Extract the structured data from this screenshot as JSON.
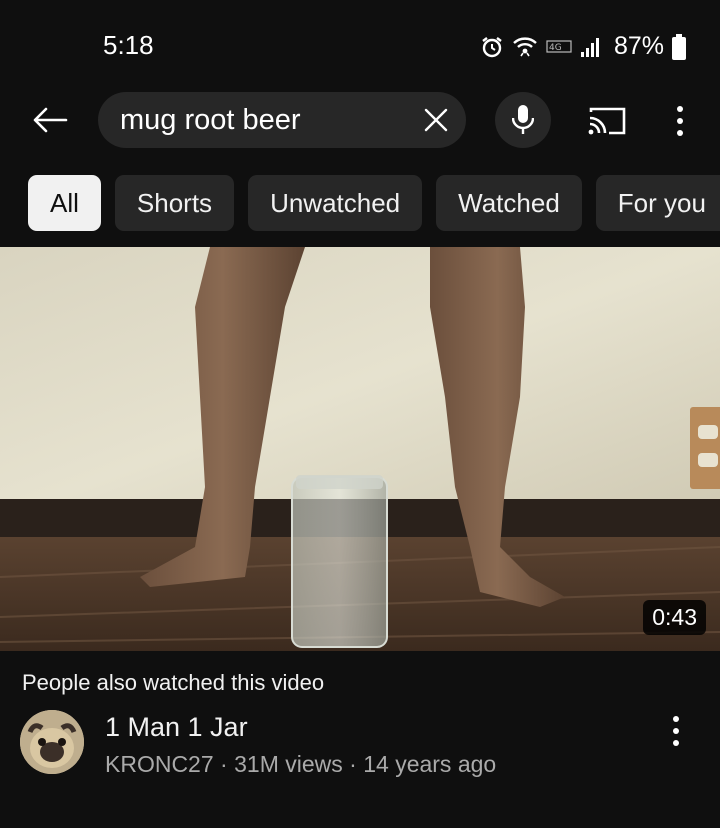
{
  "status_bar": {
    "time": "5:18",
    "battery": "87%"
  },
  "search": {
    "query": "mug root beer"
  },
  "chips": [
    "All",
    "Shorts",
    "Unwatched",
    "Watched",
    "For you"
  ],
  "video": {
    "duration": "0:43"
  },
  "related": {
    "section_title": "People also watched this video",
    "title": "1 Man 1 Jar",
    "channel": "KRONC27",
    "separator": "·",
    "views": "31M views",
    "age": "14 years ago"
  },
  "colors": {
    "background": "#0f0f0f",
    "chip_bg": "#272727",
    "chip_active_bg": "#f1f1f1",
    "meta_text": "#aaaaaa"
  },
  "icons": {
    "back": "arrow-left-icon",
    "clear": "close-icon",
    "mic": "microphone-icon",
    "cast": "cast-icon",
    "more": "more-vertical-icon",
    "alarm": "alarm-icon",
    "wifi": "wifi-icon",
    "signal": "signal-icon",
    "battery": "battery-icon"
  }
}
